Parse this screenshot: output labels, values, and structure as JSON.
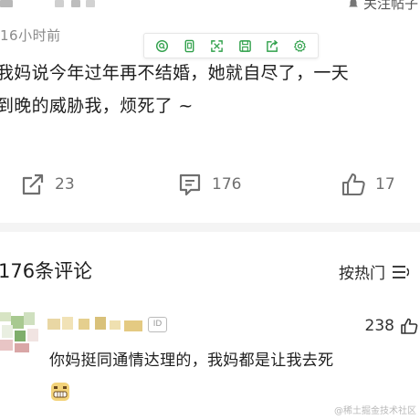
{
  "header": {
    "follow_label": "关注帖子",
    "time_ago": "16小时前"
  },
  "toolbar": {
    "items": [
      "search-icon",
      "copy-icon",
      "expand-icon",
      "save-icon",
      "share-icon",
      "settings-icon"
    ],
    "accent_color": "#2fa04a"
  },
  "post": {
    "line1": "我妈说今年过年再不结婚，她就自尽了，一天",
    "line2": "到晚的威胁我，烦死了 ~"
  },
  "actions": {
    "share_count": "23",
    "comment_count": "176",
    "like_count": "17"
  },
  "comments_section": {
    "title": "176条评论",
    "sort_label": "按热门"
  },
  "comment": {
    "id_badge": "ID",
    "likes": "238",
    "text": "你妈挺同通情达理的，我妈都是让我去死"
  },
  "watermark": "@稀土掘金技术社区"
}
